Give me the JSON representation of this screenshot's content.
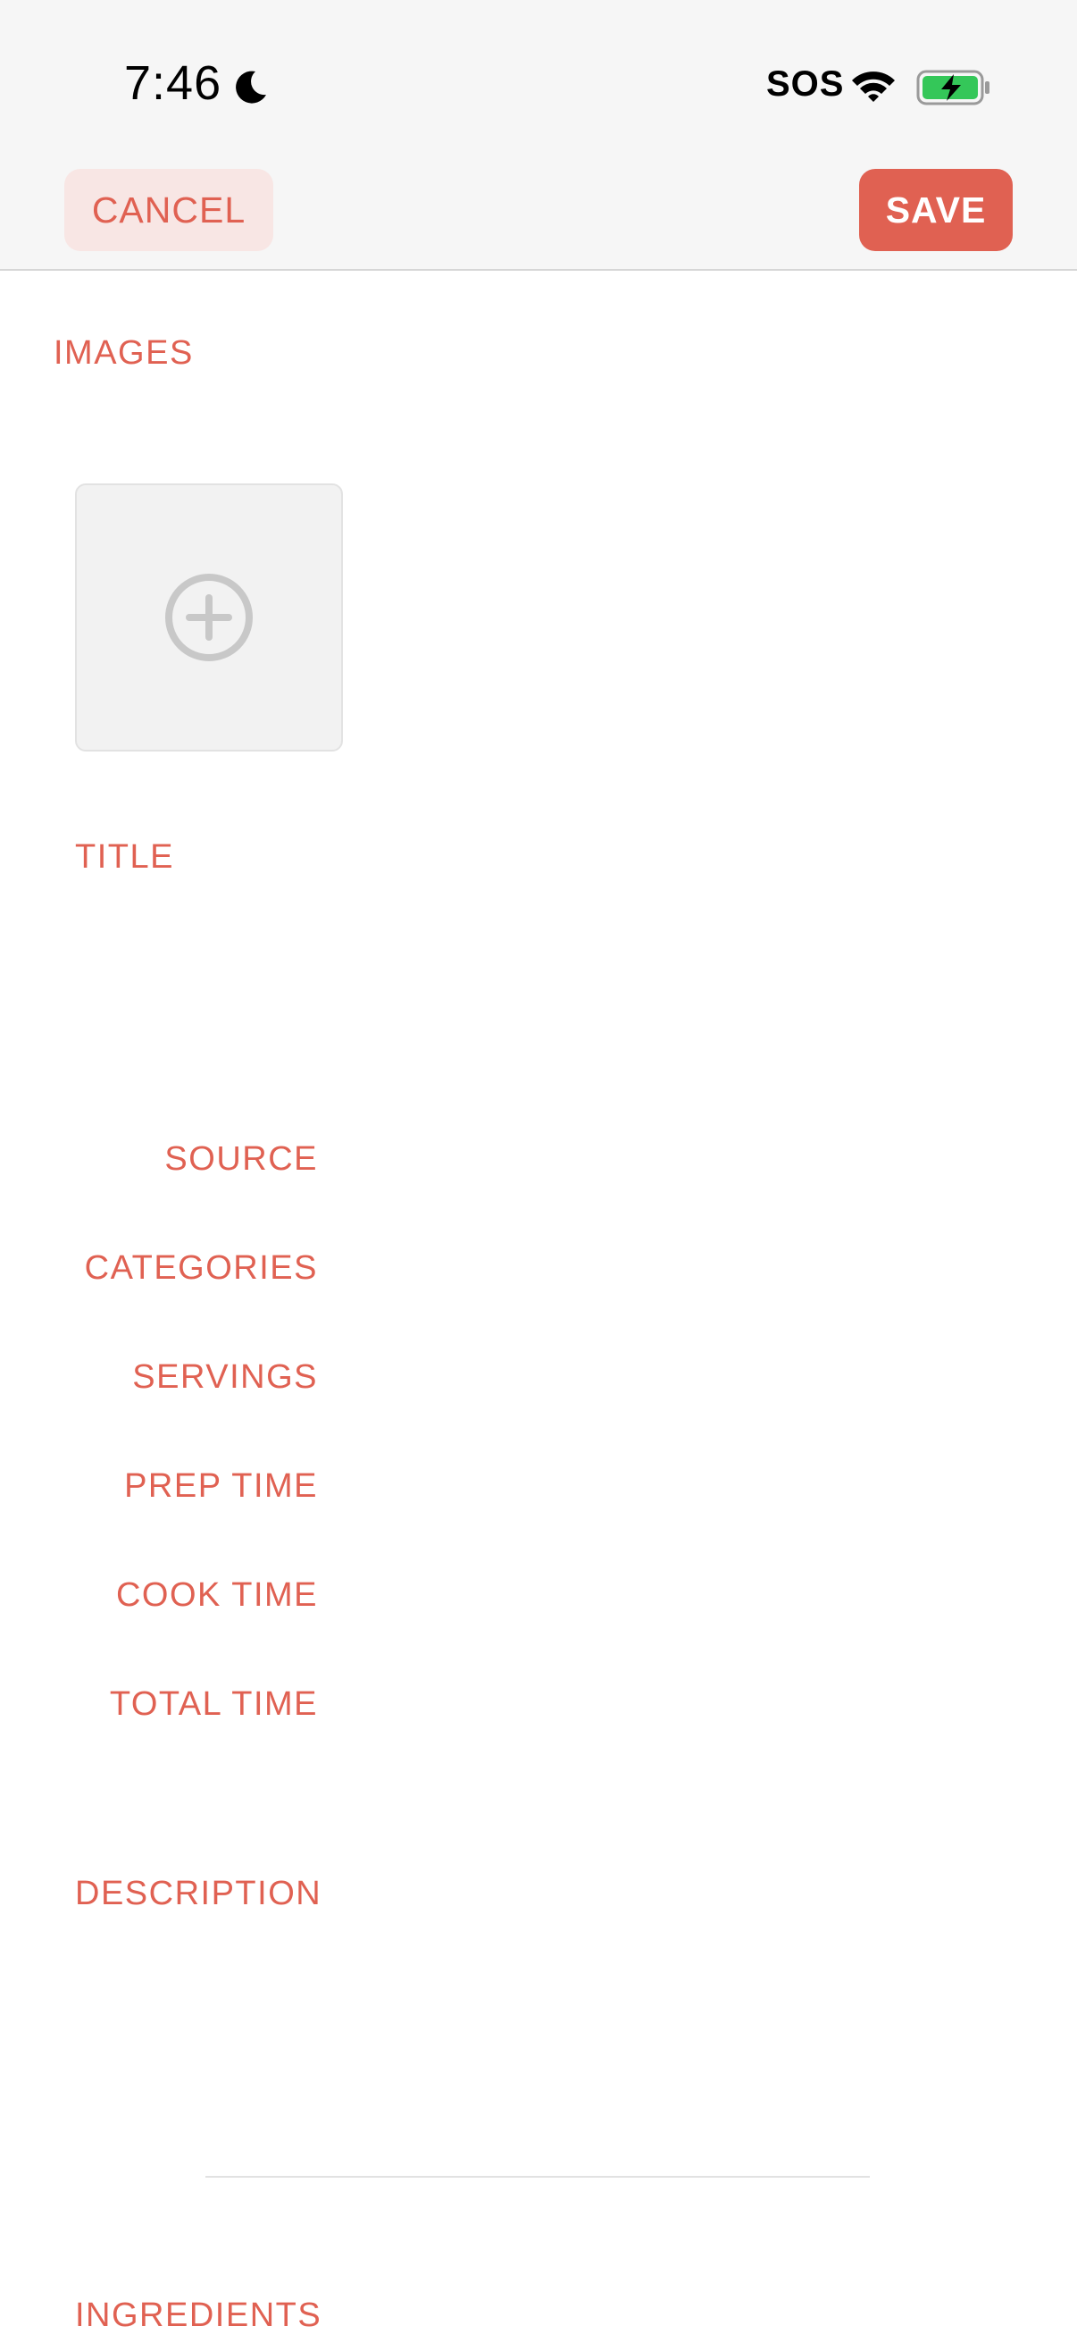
{
  "status_bar": {
    "time": "7:46",
    "sos_label": "SOS",
    "icons": [
      "moon-icon",
      "wifi-icon",
      "battery-charging-icon"
    ]
  },
  "header": {
    "cancel_label": "CANCEL",
    "save_label": "SAVE"
  },
  "images": {
    "label": "IMAGES",
    "add_icon": "plus-circle-icon"
  },
  "fields": {
    "title_label": "TITLE",
    "source_label": "SOURCE",
    "categories_label": "CATEGORIES",
    "servings_label": "SERVINGS",
    "prep_time_label": "PREP TIME",
    "cook_time_label": "COOK TIME",
    "total_time_label": "TOTAL TIME",
    "description_label": "DESCRIPTION",
    "ingredients_label": "INGREDIENTS"
  },
  "colors": {
    "accent": "#E06152",
    "cancel_bg": "#F8E6E4",
    "topbar_bg": "#F6F6F6",
    "battery_green": "#34C759"
  }
}
